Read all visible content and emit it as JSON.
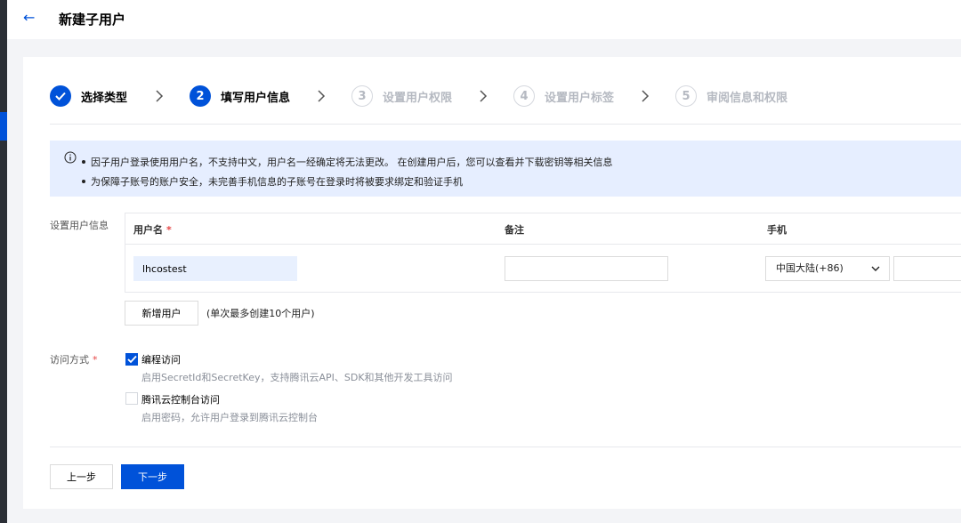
{
  "header": {
    "title": "新建子用户",
    "accent_color": "#0052d9"
  },
  "steps": [
    {
      "number": "",
      "label": "选择类型",
      "state": "done"
    },
    {
      "number": "2",
      "label": "填写用户信息",
      "state": "active"
    },
    {
      "number": "3",
      "label": "设置用户权限",
      "state": "todo"
    },
    {
      "number": "4",
      "label": "设置用户标签",
      "state": "todo"
    },
    {
      "number": "5",
      "label": "审阅信息和权限",
      "state": "todo"
    }
  ],
  "notice": {
    "lines": [
      "因子用户登录使用用户名，不支持中文，用户名一经确定将无法更改。 在创建用户后，您可以查看并下载密钥等相关信息",
      "为保障子账号的账户安全，未完善手机信息的子账号在登录时将被要求绑定和验证手机"
    ]
  },
  "user_info": {
    "section_label": "设置用户信息",
    "columns": {
      "username": "用户名",
      "remark": "备注",
      "phone": "手机"
    },
    "username_required_mark": "*",
    "row": {
      "username": "lhcostest",
      "remark": "",
      "country_code": "中国大陆(+86)",
      "phone": ""
    },
    "add_user_button": "新增用户",
    "add_user_hint": "(单次最多创建10个用户)"
  },
  "access": {
    "section_label": "访问方式",
    "required_mark": "*",
    "options": [
      {
        "label": "编程访问",
        "description": "启用SecretId和SecretKey，支持腾讯云API、SDK和其他开发工具访问",
        "checked": true
      },
      {
        "label": "腾讯云控制台访问",
        "description": "启用密码，允许用户登录到腾讯云控制台",
        "checked": false
      }
    ]
  },
  "footer": {
    "prev_button": "上一步",
    "next_button": "下一步"
  }
}
